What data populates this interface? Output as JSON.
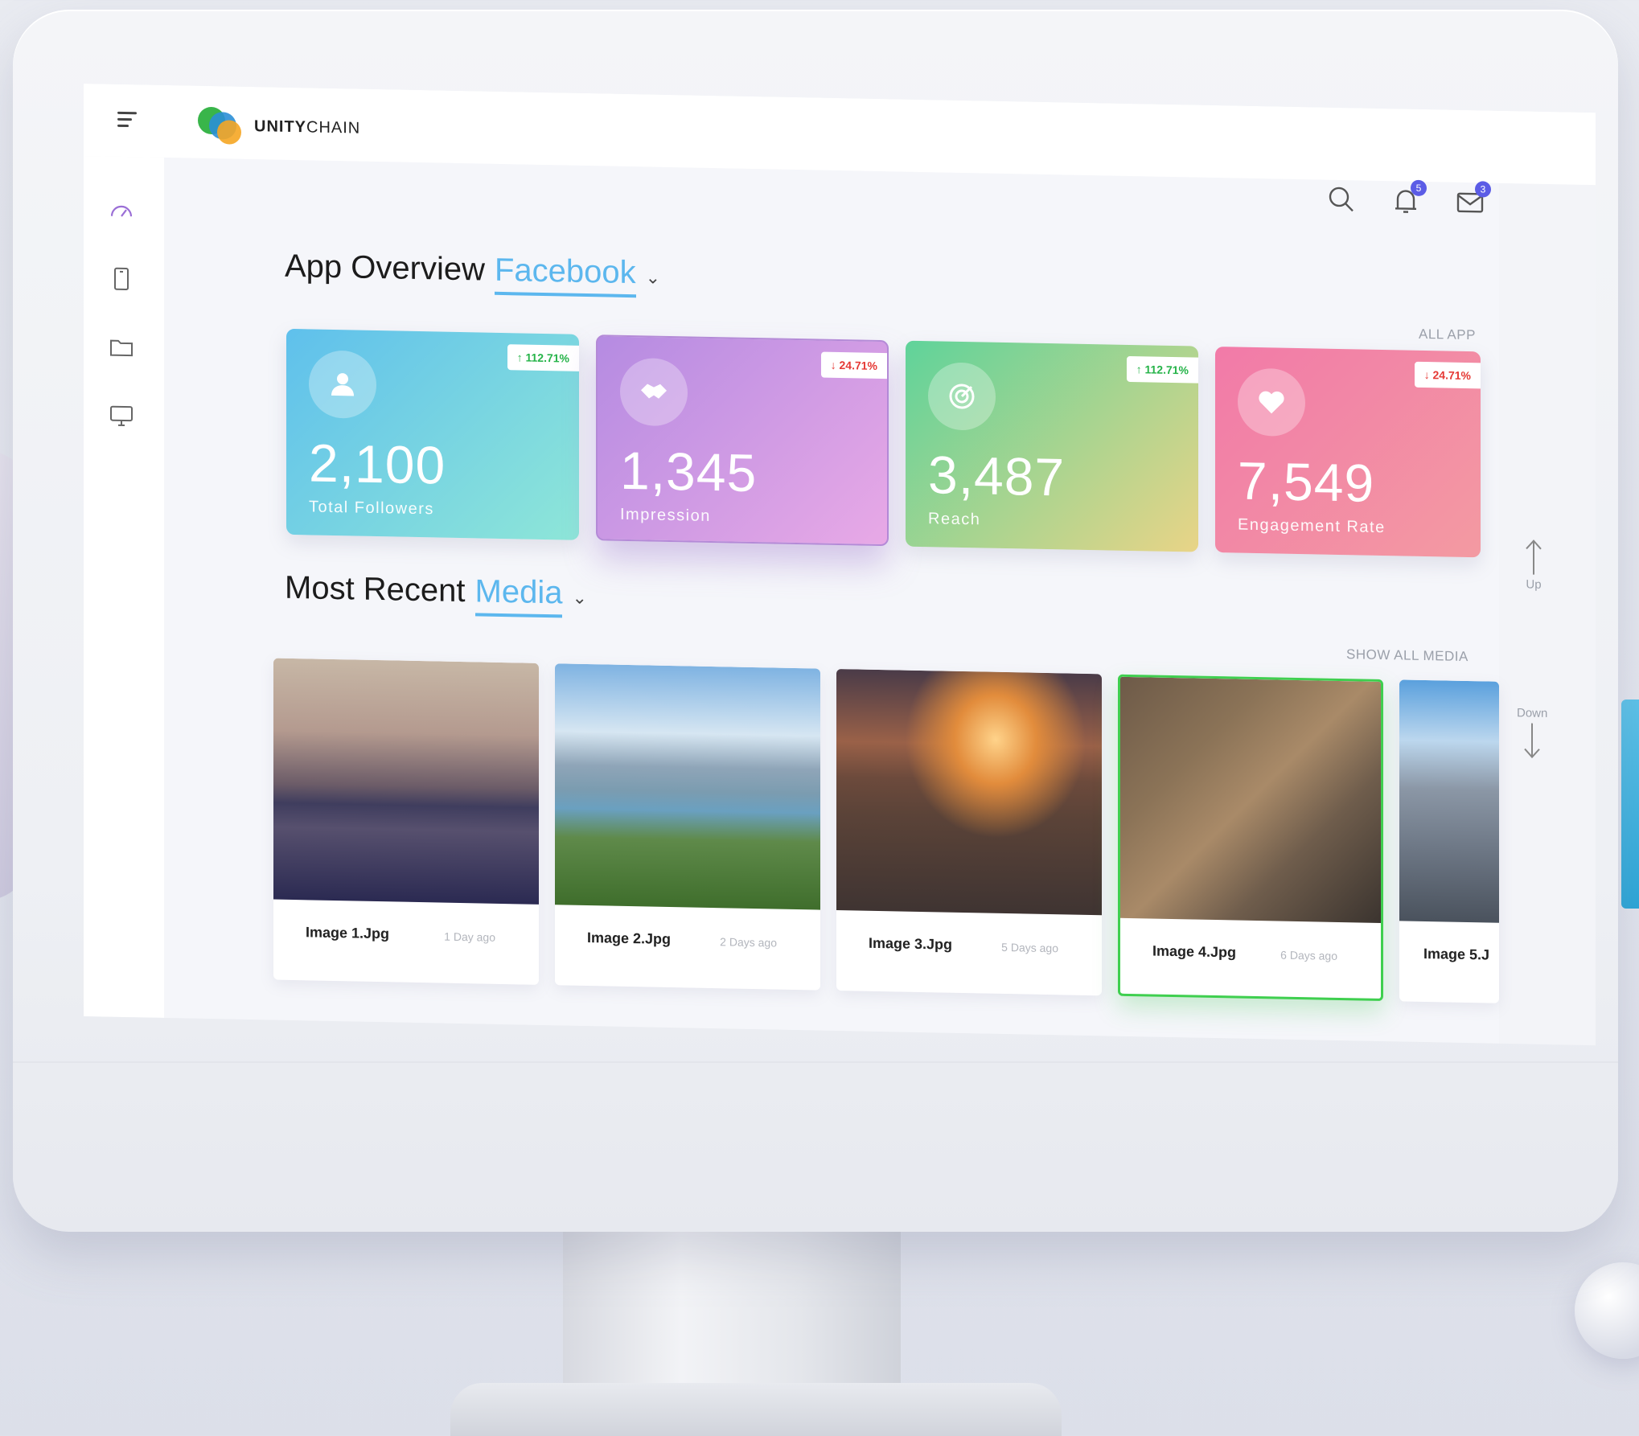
{
  "app": {
    "brand_bold": "UNITY",
    "brand_light": "CHAIN"
  },
  "header": {
    "notifications_count": "5",
    "messages_count": "3"
  },
  "overview": {
    "title": "App Overview",
    "platform": "Facebook",
    "all_app_label": "ALL APP",
    "cards": [
      {
        "value": "2,100",
        "label": "Total Followers",
        "change": "112.71%",
        "direction": "up",
        "icon": "user-icon",
        "gradient": [
          "#5fc0ec",
          "#8ee6d8"
        ]
      },
      {
        "value": "1,345",
        "label": "Impression",
        "change": "24.71%",
        "direction": "down",
        "icon": "handshake-icon",
        "gradient": [
          "#b58be2",
          "#e8a9e6"
        ]
      },
      {
        "value": "3,487",
        "label": "Reach",
        "change": "112.71%",
        "direction": "up",
        "icon": "target-icon",
        "gradient": [
          "#5fd39a",
          "#e9d487"
        ]
      },
      {
        "value": "7,549",
        "label": "Engagement Rate",
        "change": "24.71%",
        "direction": "down",
        "icon": "heart-icon",
        "gradient": [
          "#f27aa8",
          "#f39aa2"
        ]
      }
    ]
  },
  "media": {
    "title": "Most Recent",
    "accent": "Media",
    "show_all_label": "SHOW ALL MEDIA",
    "items": [
      {
        "name": "Image 1.Jpg",
        "date": "1 Day ago"
      },
      {
        "name": "Image 2.Jpg",
        "date": "2 Days ago"
      },
      {
        "name": "Image 3.Jpg",
        "date": "5 Days ago"
      },
      {
        "name": "Image 4.Jpg",
        "date": "6 Days ago"
      },
      {
        "name": "Image 5.J",
        "date": ""
      }
    ],
    "up_label": "Up",
    "down_label": "Down"
  },
  "colors": {
    "accent": "#5cb7ee",
    "up": "#27b44a",
    "down": "#e53935",
    "selected": "#3fcf4f"
  }
}
